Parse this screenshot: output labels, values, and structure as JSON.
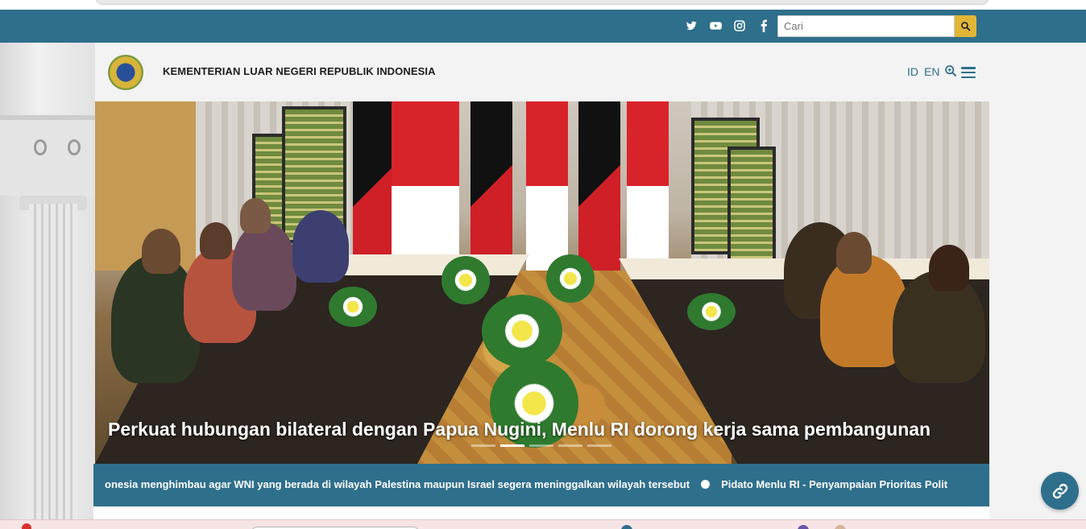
{
  "topbar": {
    "social_icons": [
      "twitter-icon",
      "youtube-icon",
      "instagram-icon",
      "facebook-icon"
    ],
    "search": {
      "placeholder": "Cari",
      "button_icon": "search-icon"
    }
  },
  "header": {
    "org_name": "KEMENTERIAN LUAR NEGERI REPUBLIK INDONESIA",
    "lang_id": "ID",
    "lang_en": "EN",
    "zoom_icon": "zoom-icon",
    "menu_icon": "hamburger-icon"
  },
  "hero": {
    "caption": "Perkuat hubungan bilateral dengan Papua Nugini, Menlu RI dorong kerja sama pembangunan",
    "slides_total": 5,
    "active_slide": 2
  },
  "ticker": {
    "item1": "onesia menghimbau agar WNI yang berada di wilayah Palestina maupun Israel segera meninggalkan wilayah tersebut",
    "item2": "Pidato Menlu RI - Penyampaian Prioritas Polit"
  },
  "fab": {
    "icon": "link-icon"
  },
  "colors": {
    "primary": "#2e6f8c",
    "accent": "#e0b637",
    "badge": "#d9322f"
  }
}
